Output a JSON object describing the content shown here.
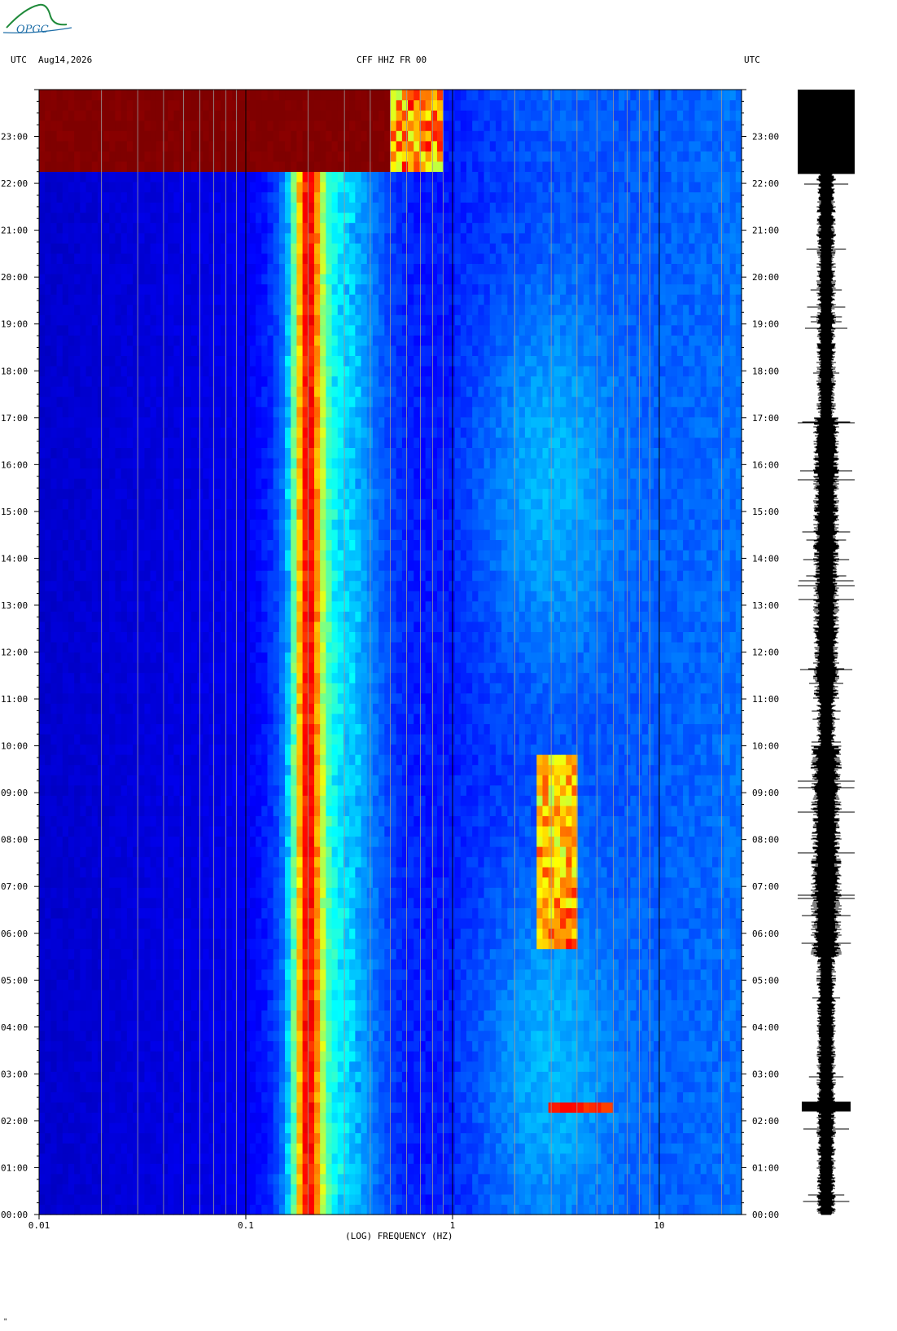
{
  "logo": {
    "text": "OPGC",
    "color": "#1f8a3a"
  },
  "header": {
    "left_tz": "UTC",
    "date": "Aug14,2026",
    "station": "CFF HHZ FR 00",
    "right_tz": "UTC"
  },
  "xaxis": {
    "label": "(LOG) FREQUENCY (HZ)",
    "ticks": [
      {
        "v": 0.01,
        "label": "0.01"
      },
      {
        "v": 0.1,
        "label": "0.1"
      },
      {
        "v": 1,
        "label": "1"
      },
      {
        "v": 10,
        "label": "10"
      }
    ]
  },
  "footer_mark": "\"",
  "chart_data": {
    "type": "heatmap",
    "title": "CFF HHZ FR 00",
    "date": "Aug14,2026",
    "xlabel": "(LOG) FREQUENCY (HZ)",
    "xscale": "log",
    "xlim": [
      0.01,
      25
    ],
    "ylim": [
      0,
      24
    ],
    "y_unit": "UTC hour",
    "y_ticks": [
      "00:00",
      "01:00",
      "02:00",
      "03:00",
      "04:00",
      "05:00",
      "06:00",
      "07:00",
      "08:00",
      "09:00",
      "10:00",
      "11:00",
      "12:00",
      "13:00",
      "14:00",
      "15:00",
      "16:00",
      "17:00",
      "18:00",
      "19:00",
      "20:00",
      "21:00",
      "22:00",
      "23:00"
    ],
    "colormap": [
      "#00007f",
      "#0000ff",
      "#00ffff",
      "#ffff00",
      "#ff0000",
      "#7f0000"
    ],
    "features": {
      "microseism_peak_hz": 0.2,
      "secondary_band_hz": [
        0.13,
        0.28
      ],
      "tonal_line_hz": 1.6,
      "saturated_block_hours": [
        22.2,
        24
      ],
      "saturated_block_max_hz": 0.5,
      "long_period_line_hour": 17.25,
      "high_noise_band_hz": [
        2.5,
        4.0
      ],
      "high_noise_band_hours": [
        5.7,
        9.9
      ],
      "event_hour": 2.3,
      "event_freq_hz": [
        3,
        6
      ]
    },
    "grid": true,
    "waveform_panel": "right"
  }
}
